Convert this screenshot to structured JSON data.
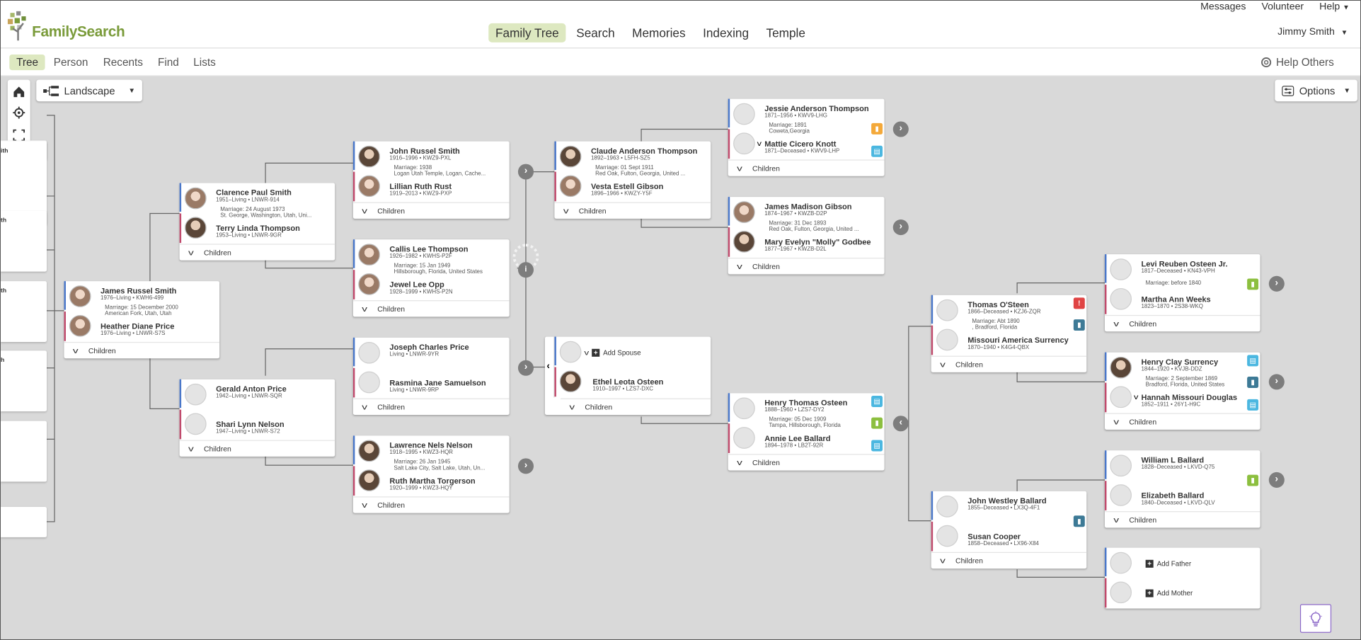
{
  "header": {
    "logo_text": "FamilySearch",
    "nav": [
      {
        "label": "Family Tree",
        "active": true
      },
      {
        "label": "Search"
      },
      {
        "label": "Memories"
      },
      {
        "label": "Indexing"
      },
      {
        "label": "Temple"
      }
    ],
    "utility": {
      "messages": "Messages",
      "volunteer": "Volunteer",
      "help": "Help"
    },
    "user": "Jimmy Smith"
  },
  "subnav": {
    "items": [
      "Tree",
      "Person",
      "Recents",
      "Find",
      "Lists"
    ],
    "help_others": "Help Others"
  },
  "toolbar": {
    "view": "Landscape",
    "options": "Options"
  },
  "left_stub": [
    "ith",
    "th",
    "th",
    "h"
  ],
  "children_label": "Children",
  "add_spouse": "Add Spouse",
  "add_father": "Add Father",
  "add_mother": "Add Mother",
  "cards": {
    "c_james": {
      "h": {
        "name": "James Russel Smith",
        "det": "1976–Living • KWH6-499"
      },
      "w": {
        "name": "Heather Diane Price",
        "det": "1976–Living • LNWR-S7S"
      },
      "m1": "Marriage: 15 December 2000",
      "m2": "American Fork, Utah, Utah"
    },
    "c_clarence": {
      "h": {
        "name": "Clarence Paul Smith",
        "det": "1951–Living • LNWR-914"
      },
      "w": {
        "name": "Terry Linda Thompson",
        "det": "1953–Living • LNWR-9GR"
      },
      "m1": "Marriage: 24 August 1973",
      "m2": "St. George, Washington, Utah, Uni..."
    },
    "c_gerald": {
      "h": {
        "name": "Gerald Anton Price",
        "det": "1942–Living • LNWR-SQR"
      },
      "w": {
        "name": "Shari Lynn Nelson",
        "det": "1947–Living • LNWR-S72"
      },
      "m1": "",
      "m2": ""
    },
    "c_john": {
      "h": {
        "name": "John Russel Smith",
        "det": "1916–1996 • KWZ9-PXL"
      },
      "w": {
        "name": "Lillian Ruth Rust",
        "det": "1919–2013 • KWZ9-PXP"
      },
      "m1": "Marriage: 1938",
      "m2": "Logan Utah Temple, Logan, Cache..."
    },
    "c_callis": {
      "h": {
        "name": "Callis Lee Thompson",
        "det": "1926–1982 • KWHS-P2F"
      },
      "w": {
        "name": "Jewel Lee Opp",
        "det": "1928–1999 • KWHS-P2N"
      },
      "m1": "Marriage: 15 Jan 1949",
      "m2": "Hillsborough, Florida, United States"
    },
    "c_joseph": {
      "h": {
        "name": "Joseph Charles Price",
        "det": "Living • LNWR-9YR"
      },
      "w": {
        "name": "Rasmina Jane Samuelson",
        "det": "Living • LNWR-9RP"
      },
      "m1": "",
      "m2": ""
    },
    "c_lawrence": {
      "h": {
        "name": "Lawrence Nels Nelson",
        "det": "1918–1995 • KWZ3-HQR"
      },
      "w": {
        "name": "Ruth Martha Torgerson",
        "det": "1920–1999 • KWZ3-HQY"
      },
      "m1": "Marriage: 26 Jan 1945",
      "m2": "Salt Lake City, Salt Lake, Utah, Un..."
    },
    "c_claude": {
      "h": {
        "name": "Claude Anderson Thompson",
        "det": "1892–1963 • L5FH-SZ5"
      },
      "w": {
        "name": "Vesta Estell Gibson",
        "det": "1896–1966 • KWZY-Y5F"
      },
      "m1": "Marriage: 01 Sept 1911",
      "m2": "Red Oak, Fulton, Georgia, United ..."
    },
    "c_ethel": {
      "w": {
        "name": "Ethel Leota Osteen",
        "det": "1910–1997 • LZS7-DXC"
      }
    },
    "c_jessie": {
      "h": {
        "name": "Jessie Anderson Thompson",
        "det": "1871–1956 • KWV9-LHG"
      },
      "w": {
        "name": "Mattie Cicero Knott",
        "det": "1871–Deceased • KWV9-LHP"
      },
      "m1": "Marriage: 1891",
      "m2": "Coweta,Georgia"
    },
    "c_jamesm": {
      "h": {
        "name": "James Madison Gibson",
        "det": "1874–1967 • KWZB-D2P"
      },
      "w": {
        "name": "Mary Evelyn \"Molly\" Godbee",
        "det": "1877–1967 • KWZB-D2L"
      },
      "m1": "Marriage: 31 Dec 1893",
      "m2": "Red Oak, Fulton, Georgia, United ..."
    },
    "c_henryt": {
      "h": {
        "name": "Henry Thomas Osteen",
        "det": "1888–1960 • LZS7-DY2"
      },
      "w": {
        "name": "Annie Lee Ballard",
        "det": "1894–1978 • LB2T-92R"
      },
      "m1": "Marriage: 05 Dec 1909",
      "m2": "Tampa, Hillsborough, Florida"
    },
    "c_thomas": {
      "h": {
        "name": "Thomas O'Steen",
        "det": "1866–Deceased • KZJ6-ZQR"
      },
      "w": {
        "name": "Missouri America Surrency",
        "det": "1870–1940 • K4G4-QBX"
      },
      "m1": "Marriage: Abt 1890",
      "m2": ", Bradford, Florida"
    },
    "c_johnw": {
      "h": {
        "name": "John Westley Ballard",
        "det": "1855–Deceased • LX3Q-4F1"
      },
      "w": {
        "name": "Susan Cooper",
        "det": "1858–Deceased • LX96-X84"
      },
      "m1": "",
      "m2": ""
    },
    "c_levi": {
      "h": {
        "name": "Levi Reuben Osteen Jr.",
        "det": "1817–Deceased • KN43-VPH"
      },
      "w": {
        "name": "Martha Ann Weeks",
        "det": "1823–1870 • 2S38-WKQ"
      },
      "m1": "Marriage: before 1840",
      "m2": ""
    },
    "c_henryc": {
      "h": {
        "name": "Henry Clay Surrency",
        "det": "1844–1920 • KVJB-DDZ"
      },
      "w": {
        "name": "Hannah Missouri Douglas",
        "det": "1852–1911 • 26Y1-H9C"
      },
      "m1": "Marriage: 2 September 1869",
      "m2": "Bradford, Florida, United States"
    },
    "c_william": {
      "h": {
        "name": "William L Ballard",
        "det": "1828–Deceased • LKVD-Q75"
      },
      "w": {
        "name": "Elizabeth Ballard",
        "det": "1840–Deceased • LKVD-QLV"
      },
      "m1": "",
      "m2": ""
    }
  },
  "colors": {
    "accent_green": "#7a9b3a",
    "nav_active_bg": "#dde8c0",
    "male_bar": "#4a77c9",
    "female_bar": "#c04a6c",
    "canvas_bg": "#d9d9d9"
  }
}
